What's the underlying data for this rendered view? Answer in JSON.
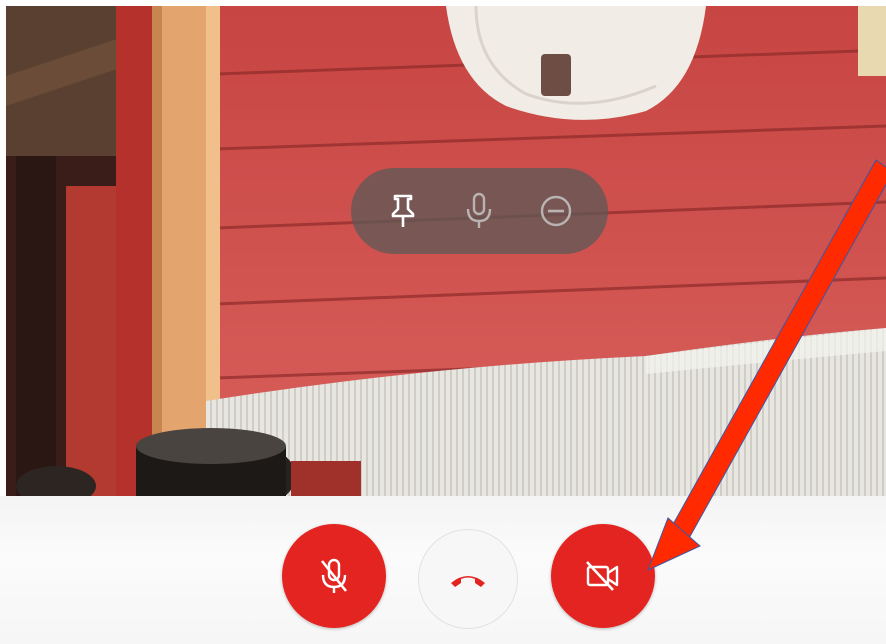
{
  "call": {
    "overlay_controls": [
      {
        "icon": "pin-icon",
        "state": "active"
      },
      {
        "icon": "microphone-icon",
        "state": "dimmed"
      },
      {
        "icon": "remove-icon",
        "state": "dimmed"
      }
    ],
    "bottom_controls": [
      {
        "icon": "microphone-off-icon",
        "state": "on",
        "color": "#e42420"
      },
      {
        "icon": "hang-up-icon",
        "state": "neutral",
        "color": "#e42420"
      },
      {
        "icon": "camera-off-icon",
        "state": "on",
        "color": "#e42420"
      }
    ]
  },
  "annotation": {
    "type": "arrow",
    "color": "#ff2a00",
    "points_to": "camera-off-button"
  }
}
